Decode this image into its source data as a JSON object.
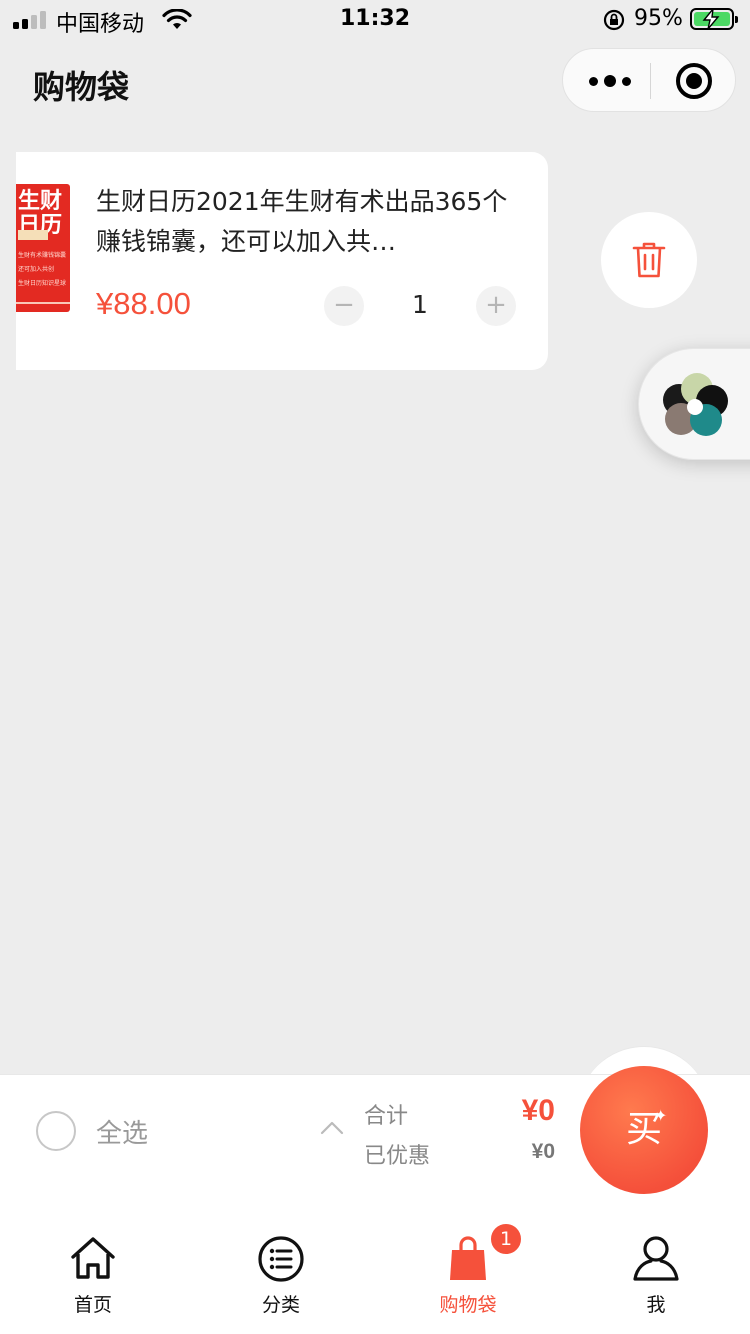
{
  "status_bar": {
    "carrier": "中国移动",
    "time": "11:32",
    "battery_percent": "95%",
    "battery_level": 0.95,
    "icons": [
      "signal-icon",
      "wifi-icon",
      "rotation-lock-icon",
      "battery-charging-icon"
    ]
  },
  "header": {
    "title": "购物袋",
    "capsule_icons": [
      "more-dots-icon",
      "target-close-icon"
    ]
  },
  "cart": {
    "items": [
      {
        "thumb_text_big": "生财日历",
        "thumb_text_small_1": "生财有术赚钱锦囊",
        "thumb_text_small_2": "还可加入共创",
        "thumb_text_small_3": "生财日历知识星球",
        "title": "生财日历2021年生财有术出品365个赚钱锦囊，还可以加入共…",
        "price": "¥88.00",
        "quantity": "1",
        "minus": "−",
        "plus": "+"
      }
    ],
    "delete_icon": "trash-icon"
  },
  "floating": {
    "icon": "app-logo-icon",
    "colors": [
      "#1a1a1a",
      "#c8d6a8",
      "#8a7a72",
      "#1f8a8a"
    ]
  },
  "checkout": {
    "select_all": "全选",
    "total_label": "合计",
    "discount_label": "已优惠",
    "total_value": "¥0",
    "discount_value": "¥0",
    "buy_label": "买",
    "buy_sparkle": "✦",
    "accent": "#f5513b"
  },
  "tabs": [
    {
      "label": "首页",
      "icon": "home-icon"
    },
    {
      "label": "分类",
      "icon": "list-icon"
    },
    {
      "label": "购物袋",
      "icon": "shopping-bag-icon",
      "badge": "1",
      "active": true
    },
    {
      "label": "我",
      "icon": "user-icon"
    }
  ]
}
